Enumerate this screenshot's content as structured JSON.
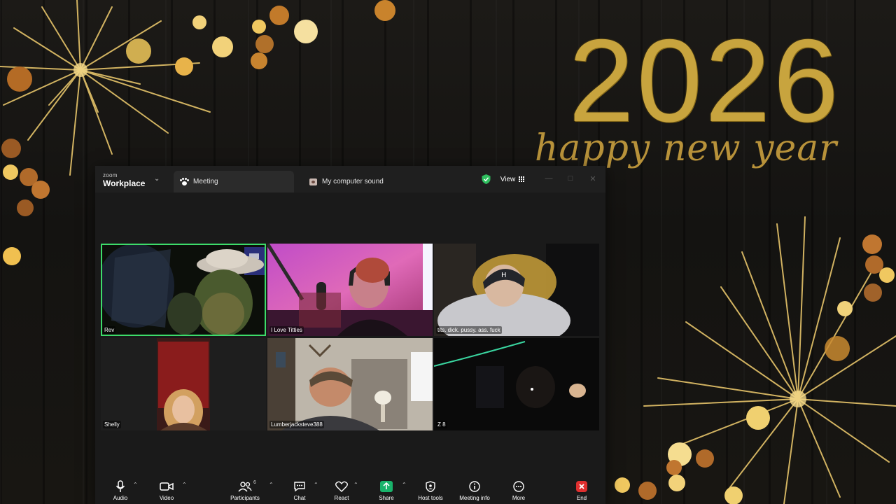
{
  "wallpaper": {
    "year": "2026",
    "greeting": "happy new year"
  },
  "window": {
    "logo_small": "zoom",
    "logo_big": "Workplace",
    "tabs": [
      {
        "label": "Meeting",
        "icon": "paw-icon",
        "active": true
      },
      {
        "label": "My computer sound",
        "icon": "speaker-icon",
        "active": false
      }
    ],
    "view_label": "View",
    "colors": {
      "accent_green": "#3ddc6a",
      "share_green": "#19b36b",
      "end_red": "#e02f2f"
    }
  },
  "participants": [
    {
      "name": "Rev",
      "speaking": true
    },
    {
      "name": "I Love Titties",
      "speaking": false
    },
    {
      "name": "tits. dick. pussy. ass. fuck",
      "speaking": false
    },
    {
      "name": "Shelly",
      "speaking": false
    },
    {
      "name": "Lumberjacksteve388",
      "speaking": false
    },
    {
      "name": "Z 8",
      "speaking": false
    }
  ],
  "toolbar": {
    "audio": "Audio",
    "video": "Video",
    "participants": "Participants",
    "participants_count": "6",
    "chat": "Chat",
    "react": "React",
    "share": "Share",
    "host_tools": "Host tools",
    "meeting_info": "Meeting info",
    "more": "More",
    "end": "End"
  }
}
